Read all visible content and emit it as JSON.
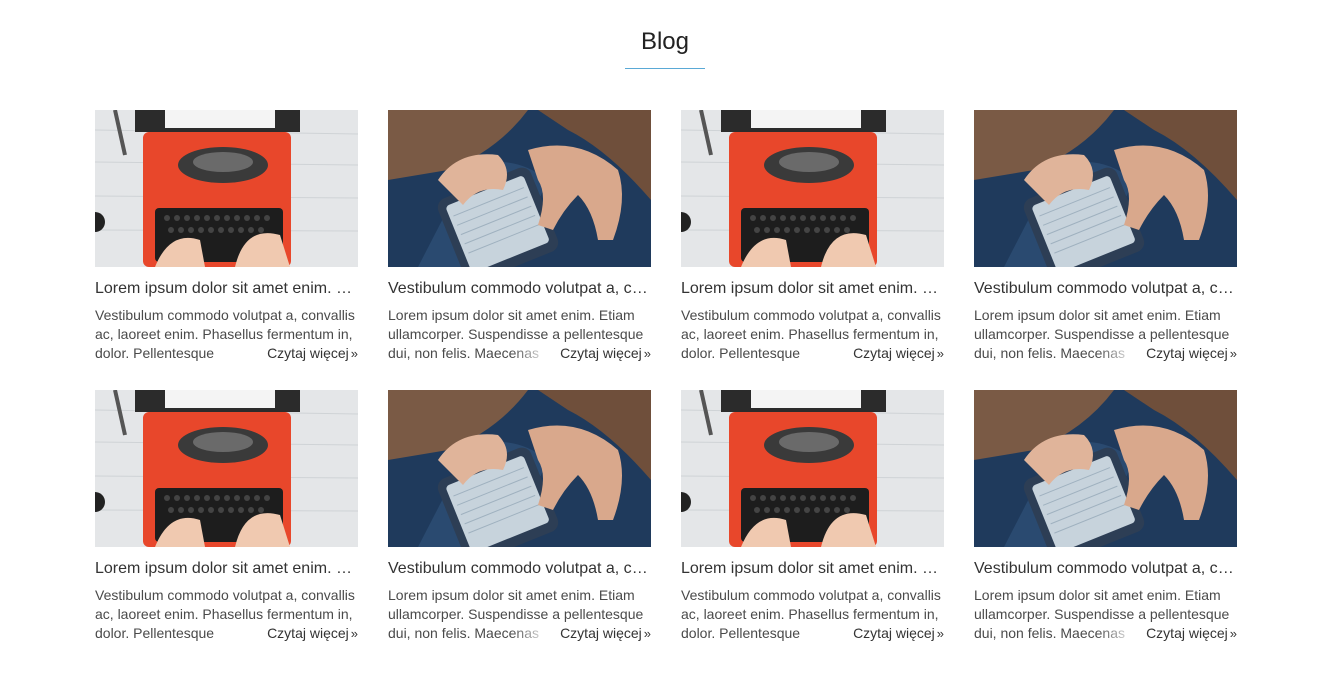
{
  "section": {
    "title": "Blog"
  },
  "posts": [
    {
      "image": "typewriter-image",
      "title": "Lorem ipsum dolor sit amet enim. Etiam",
      "excerpt": "Vestibulum commodo volutpat a, convallis ac, laoreet enim. Phasellus fermentum in, dolor. Pellentesque",
      "read_more": "Czytaj więcej",
      "read_more_icon": "»"
    },
    {
      "image": "smartphone-image",
      "title": "Vestibulum commodo volutpat a, convallis",
      "excerpt": "Lorem ipsum dolor sit amet enim. Etiam ullamcorper. Suspendisse a pellentesque dui, non felis. Maecenas",
      "read_more": "Czytaj więcej",
      "read_more_icon": "»"
    },
    {
      "image": "typewriter-image",
      "title": "Lorem ipsum dolor sit amet enim. Etiam",
      "excerpt": "Vestibulum commodo volutpat a, convallis ac, laoreet enim. Phasellus fermentum in, dolor. Pellentesque",
      "read_more": "Czytaj więcej",
      "read_more_icon": "»"
    },
    {
      "image": "smartphone-image",
      "title": "Vestibulum commodo volutpat a, convallis",
      "excerpt": "Lorem ipsum dolor sit amet enim. Etiam ullamcorper. Suspendisse a pellentesque dui, non felis. Maecenas",
      "read_more": "Czytaj więcej",
      "read_more_icon": "»"
    },
    {
      "image": "typewriter-image",
      "title": "Lorem ipsum dolor sit amet enim. Etiam",
      "excerpt": "Vestibulum commodo volutpat a, convallis ac, laoreet enim. Phasellus fermentum in, dolor. Pellentesque",
      "read_more": "Czytaj więcej",
      "read_more_icon": "»"
    },
    {
      "image": "smartphone-image",
      "title": "Vestibulum commodo volutpat a, convallis",
      "excerpt": "Lorem ipsum dolor sit amet enim. Etiam ullamcorper. Suspendisse a pellentesque dui, non felis. Maecenas",
      "read_more": "Czytaj więcej",
      "read_more_icon": "»"
    },
    {
      "image": "typewriter-image",
      "title": "Lorem ipsum dolor sit amet enim. Etiam",
      "excerpt": "Vestibulum commodo volutpat a, convallis ac, laoreet enim. Phasellus fermentum in, dolor. Pellentesque",
      "read_more": "Czytaj więcej",
      "read_more_icon": "»"
    },
    {
      "image": "smartphone-image",
      "title": "Vestibulum commodo volutpat a, convallis",
      "excerpt": "Lorem ipsum dolor sit amet enim. Etiam ullamcorper. Suspendisse a pellentesque dui, non felis. Maecenas",
      "read_more": "Czytaj więcej",
      "read_more_icon": "»"
    }
  ],
  "colors": {
    "accent_underline": "#5aa9d6",
    "typewriter_body": "#e8472b",
    "phone_background": "#1f3a5c"
  }
}
